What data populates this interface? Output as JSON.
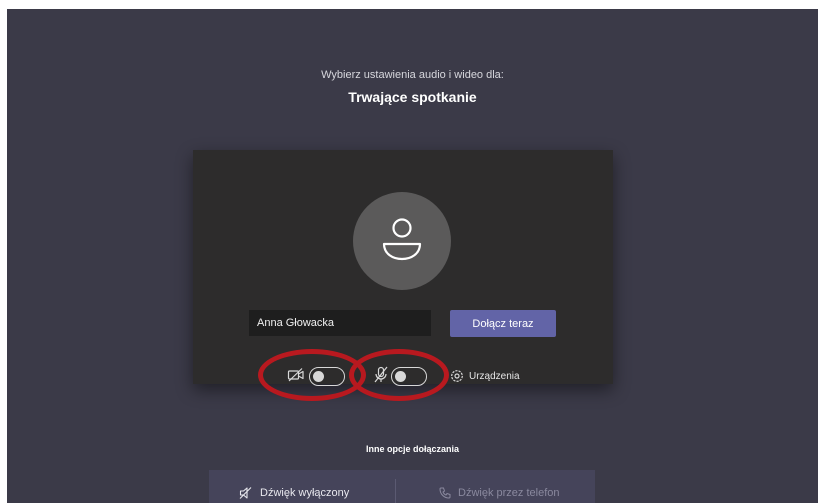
{
  "header": {
    "subtitle": "Wybierz ustawienia audio i wideo dla:",
    "title": "Trwające spotkanie"
  },
  "prejoin": {
    "name_value": "Anna Głowacka",
    "join_label": "Dołącz teraz",
    "devices_label": "Urządzenia",
    "camera_toggle": "off",
    "mic_toggle": "off"
  },
  "other_options": {
    "label": "Inne opcje dołączania",
    "audio_off_label": "Dźwięk wyłączony",
    "phone_audio_label": "Dźwięk przez telefon"
  },
  "colors": {
    "background": "#3b3a48",
    "card": "#2d2c2c",
    "accent": "#6264a7",
    "annotation": "#b8191f"
  }
}
